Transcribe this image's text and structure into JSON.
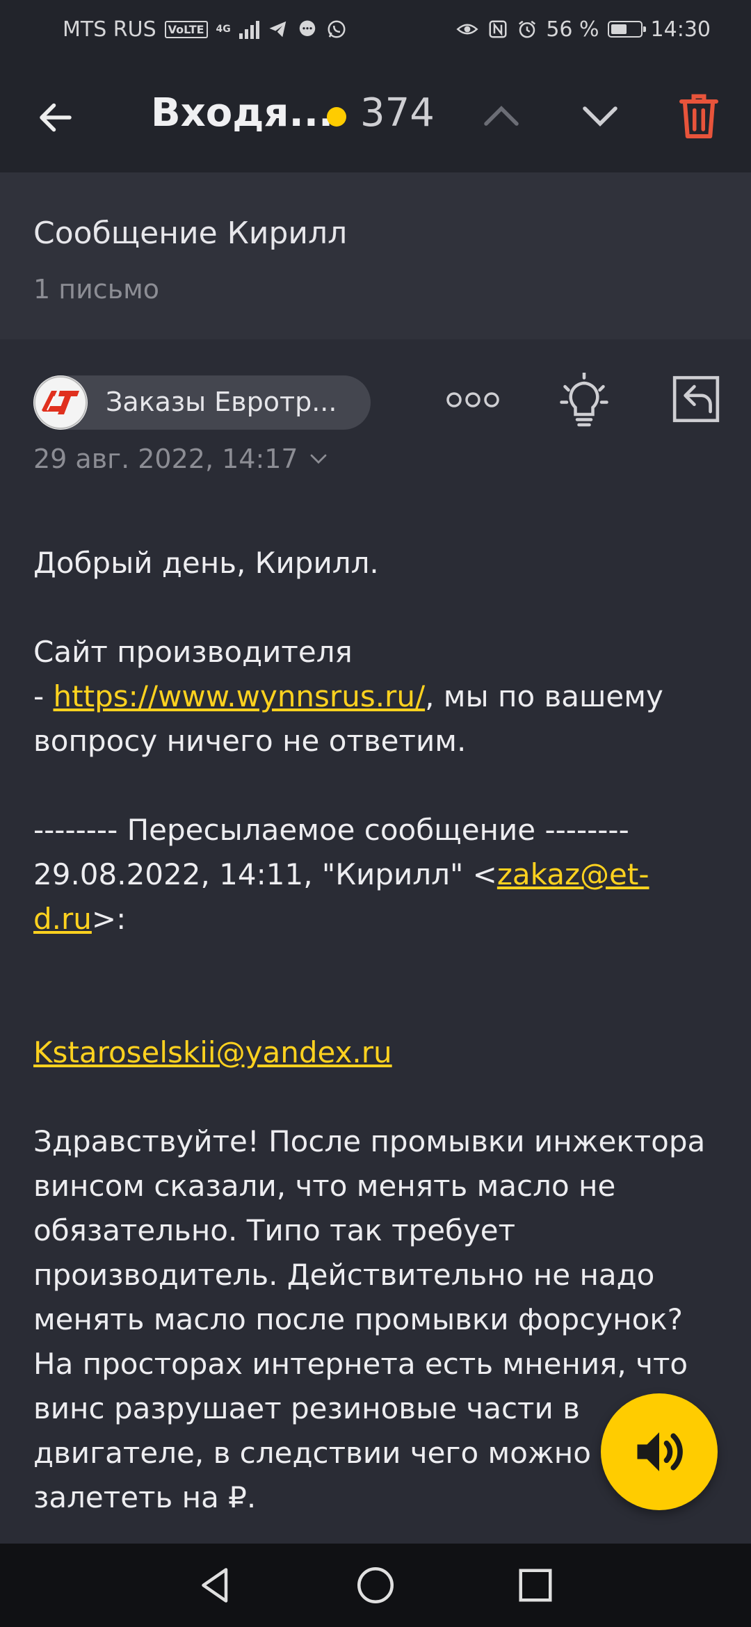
{
  "status": {
    "carrier": "MTS RUS",
    "volte": "VoLTE",
    "network": "4G",
    "battery_percent": "56 %",
    "battery_level": 0.56,
    "time": "14:30"
  },
  "appbar": {
    "title": "Входя...",
    "unread_count": "374",
    "accent": "#ffcc00",
    "trash_color": "#e8543b"
  },
  "thread": {
    "subject": "Сообщение Кирилл",
    "letters": "1 письмо"
  },
  "message": {
    "sender": "Заказы Евротр...",
    "date": "29 авг. 2022, 14:17",
    "greeting": "Добрый день, Кирилл.",
    "line1": "Сайт производителя",
    "dash": "- ",
    "site_link": "https://www.wynnsrus.ru/",
    "line2_after": ", мы по вашему",
    "line3": "вопросу ничего не ответим.",
    "fwd_header": "-------- Пересылаемое сообщение --------",
    "fwd_from_pre": "29.08.2022, 14:11, \"Кирилл\" <",
    "fwd_email": "zakaz@et-d.ru",
    "fwd_from_post": ">:",
    "contact_email": "Kstaroselskii@yandex.ru",
    "question": "Здравствуйте! После промывки инжектора винсом сказали, что менять масло не обязательно. Типо так требует производитель. Действительно не надо менять масло после промывки форсунок? На просторах интернета есть мнения, что винс разрушает резиновые части в двигателе, в следствии чего можно залететь на ₽."
  }
}
